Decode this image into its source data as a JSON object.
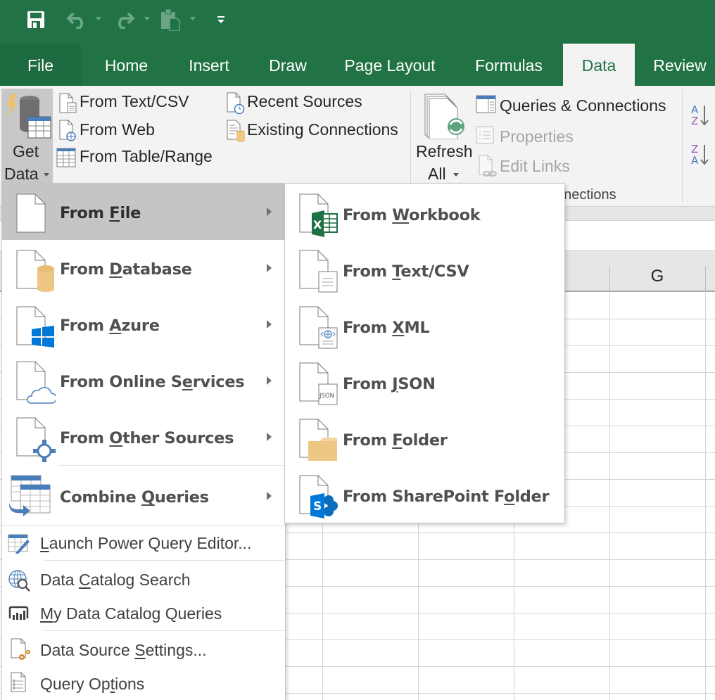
{
  "qat": {
    "save_icon": "save-icon",
    "undo_icon": "undo-icon",
    "redo_icon": "redo-icon",
    "paste_icon": "paste-icon",
    "customize_icon": "customize-qat-icon"
  },
  "tabs": [
    {
      "label": "File",
      "active": false
    },
    {
      "label": "Home",
      "active": false
    },
    {
      "label": "Insert",
      "active": false
    },
    {
      "label": "Draw",
      "active": false
    },
    {
      "label": "Page Layout",
      "active": false
    },
    {
      "label": "Formulas",
      "active": false
    },
    {
      "label": "Data",
      "active": true
    },
    {
      "label": "Review",
      "active": false
    }
  ],
  "ribbon": {
    "get_data": {
      "line1": "Get",
      "line2": "Data"
    },
    "get_transform": [
      {
        "label": "From Text/CSV",
        "icon": "text-file-icon"
      },
      {
        "label": "From Web",
        "icon": "web-file-icon"
      },
      {
        "label": "From Table/Range",
        "icon": "table-icon"
      },
      {
        "label": "Recent Sources",
        "icon": "recent-sources-icon"
      },
      {
        "label": "Existing Connections",
        "icon": "existing-connections-icon"
      }
    ],
    "refresh_all": {
      "line1": "Refresh",
      "line2": "All"
    },
    "queries": [
      {
        "label": "Queries & Connections",
        "enabled": true
      },
      {
        "label": "Properties",
        "enabled": false
      },
      {
        "label": "Edit Links",
        "enabled": false
      }
    ],
    "group_label_partial": "nnections",
    "sort_az_icon": "sort-a-z-icon",
    "sort_za_icon": "sort-z-a-icon"
  },
  "sheet": {
    "visible_column_label": "G"
  },
  "get_data_menu": {
    "items": [
      {
        "pre": "From ",
        "ul": "F",
        "post": "ile",
        "icon": "file-icon",
        "submenu": true,
        "highlighted": true
      },
      {
        "pre": "From ",
        "ul": "D",
        "post": "atabase",
        "icon": "database-icon",
        "submenu": true
      },
      {
        "pre": "From ",
        "ul": "A",
        "post": "zure",
        "icon": "azure-icon",
        "submenu": true
      },
      {
        "pre": "From Online S",
        "ul": "e",
        "post": "rvices",
        "icon": "online-services-icon",
        "submenu": true
      },
      {
        "pre": "From ",
        "ul": "O",
        "post": "ther Sources",
        "icon": "other-sources-icon",
        "submenu": true
      },
      {
        "pre": "Combine ",
        "ul": "Q",
        "post": "ueries",
        "icon": "combine-queries-icon",
        "submenu": true
      }
    ],
    "actions": [
      {
        "pre": "",
        "ul": "L",
        "post": "aunch Power Query Editor...",
        "icon": "power-query-editor-icon"
      },
      {
        "pre": "Data ",
        "ul": "C",
        "post": "atalog Search",
        "icon": "data-catalog-search-icon"
      },
      {
        "pre": "",
        "ul": "M",
        "post": "y Data Catalog Queries",
        "icon": "my-data-catalog-queries-icon"
      },
      {
        "pre": "Data Source ",
        "ul": "S",
        "post": "ettings...",
        "icon": "data-source-settings-icon"
      },
      {
        "pre": "Query Op",
        "ul": "t",
        "post": "ions",
        "icon": "query-options-icon"
      }
    ]
  },
  "from_file_submenu": {
    "items": [
      {
        "pre": "From ",
        "ul": "W",
        "post": "orkbook",
        "icon": "excel-workbook-icon"
      },
      {
        "pre": "From ",
        "ul": "T",
        "post": "ext/CSV",
        "icon": "text-csv-icon"
      },
      {
        "pre": "From ",
        "ul": "X",
        "post": "ML",
        "icon": "xml-icon"
      },
      {
        "pre": "From ",
        "ul": "J",
        "post": "SON",
        "icon": "json-icon",
        "badge": "JSON"
      },
      {
        "pre": "From ",
        "ul": "F",
        "post": "older",
        "icon": "folder-icon"
      },
      {
        "pre": "From SharePoint F",
        "ul": "o",
        "post": "lder",
        "icon": "sharepoint-folder-icon"
      }
    ]
  },
  "colors": {
    "excel_green": "#217346",
    "ribbon_bg": "#f3f3f3",
    "menu_highlight": "#c5c5c5",
    "icon_blue": "#4a7ebb",
    "icon_gold": "#eec785",
    "azure_blue": "#0078d7",
    "sort_purple": "#9b59b6"
  }
}
